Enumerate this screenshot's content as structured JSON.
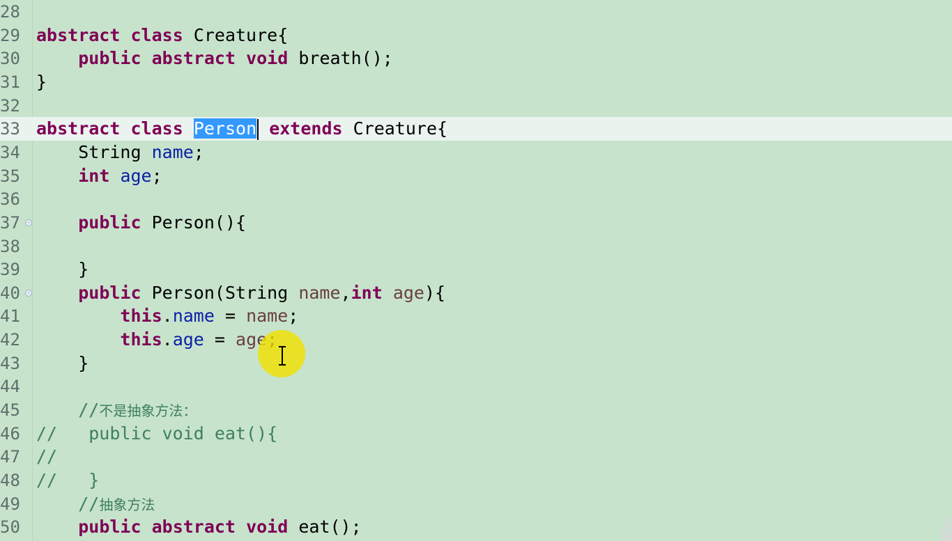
{
  "editor": {
    "lines": [
      {
        "num": "28",
        "segments": []
      },
      {
        "num": "29",
        "segments": [
          [
            "kw",
            "abstract"
          ],
          [
            "t",
            " "
          ],
          [
            "kw",
            "class"
          ],
          [
            "t",
            " Creature{"
          ]
        ]
      },
      {
        "num": "30",
        "segments": [
          [
            "t",
            "    "
          ],
          [
            "kw",
            "public"
          ],
          [
            "t",
            " "
          ],
          [
            "kw",
            "abstract"
          ],
          [
            "t",
            " "
          ],
          [
            "kw",
            "void"
          ],
          [
            "t",
            " breath();"
          ]
        ]
      },
      {
        "num": "31",
        "segments": [
          [
            "t",
            "}"
          ]
        ]
      },
      {
        "num": "32",
        "segments": []
      },
      {
        "num": "33",
        "current": true,
        "segments": [
          [
            "kw",
            "abstract"
          ],
          [
            "t",
            " "
          ],
          [
            "kw",
            "class"
          ],
          [
            "t",
            " "
          ],
          [
            "sel",
            "Person"
          ],
          [
            "caret",
            ""
          ],
          [
            "t",
            " "
          ],
          [
            "kw",
            "extends"
          ],
          [
            "t",
            " Creature{"
          ]
        ]
      },
      {
        "num": "34",
        "segments": [
          [
            "t",
            "    String "
          ],
          [
            "fld",
            "name"
          ],
          [
            "t",
            ";"
          ]
        ]
      },
      {
        "num": "35",
        "segments": [
          [
            "t",
            "    "
          ],
          [
            "kw",
            "int"
          ],
          [
            "t",
            " "
          ],
          [
            "fld",
            "age"
          ],
          [
            "t",
            ";"
          ]
        ]
      },
      {
        "num": "36",
        "segments": []
      },
      {
        "num": "37",
        "fold": true,
        "segments": [
          [
            "t",
            "    "
          ],
          [
            "kw",
            "public"
          ],
          [
            "t",
            " Person(){"
          ]
        ]
      },
      {
        "num": "38",
        "segments": []
      },
      {
        "num": "39",
        "segments": [
          [
            "t",
            "    }"
          ]
        ]
      },
      {
        "num": "40",
        "fold": true,
        "segments": [
          [
            "t",
            "    "
          ],
          [
            "kw",
            "public"
          ],
          [
            "t",
            " Person(String "
          ],
          [
            "param",
            "name"
          ],
          [
            "t",
            ","
          ],
          [
            "kw",
            "int"
          ],
          [
            "t",
            " "
          ],
          [
            "param",
            "age"
          ],
          [
            "t",
            "){"
          ]
        ]
      },
      {
        "num": "41",
        "segments": [
          [
            "t",
            "        "
          ],
          [
            "kw",
            "this"
          ],
          [
            "t",
            "."
          ],
          [
            "fld",
            "name"
          ],
          [
            "t",
            " = "
          ],
          [
            "param",
            "name"
          ],
          [
            "t",
            ";"
          ]
        ]
      },
      {
        "num": "42",
        "segments": [
          [
            "t",
            "        "
          ],
          [
            "kw",
            "this"
          ],
          [
            "t",
            "."
          ],
          [
            "fld",
            "age"
          ],
          [
            "t",
            " = "
          ],
          [
            "param",
            "age"
          ],
          [
            "t",
            ";"
          ]
        ]
      },
      {
        "num": "43",
        "segments": [
          [
            "t",
            "    }"
          ]
        ]
      },
      {
        "num": "44",
        "segments": []
      },
      {
        "num": "45",
        "segments": [
          [
            "t",
            "    "
          ],
          [
            "cmt",
            "//"
          ],
          [
            "cmtsmall",
            "不是抽象方法："
          ]
        ]
      },
      {
        "num": "46",
        "segments": [
          [
            "cmt",
            "//   public void eat(){"
          ]
        ]
      },
      {
        "num": "47",
        "segments": [
          [
            "cmt",
            "//"
          ]
        ]
      },
      {
        "num": "48",
        "segments": [
          [
            "cmt",
            "//   }"
          ]
        ]
      },
      {
        "num": "49",
        "segments": [
          [
            "t",
            "    "
          ],
          [
            "cmt",
            "//"
          ],
          [
            "cmtsmall",
            "抽象方法"
          ]
        ]
      },
      {
        "num": "50",
        "segments": [
          [
            "t",
            "    "
          ],
          [
            "kw",
            "public"
          ],
          [
            "t",
            " "
          ],
          [
            "kw",
            "abstract"
          ],
          [
            "t",
            " "
          ],
          [
            "kw",
            "void"
          ],
          [
            "t",
            " eat();"
          ]
        ]
      }
    ]
  },
  "colors": {
    "background": "#c7e3cc",
    "current_line": "#ebf3ef",
    "keyword": "#7f0055",
    "field": "#0b1ea8",
    "parameter": "#6a3e3e",
    "comment": "#3f7f5f",
    "selection": "#3399ff",
    "cursor_highlight": "#f0e000"
  },
  "icons": {
    "fold": "fold-collapse-icon",
    "cursor": "text-cursor-icon"
  }
}
